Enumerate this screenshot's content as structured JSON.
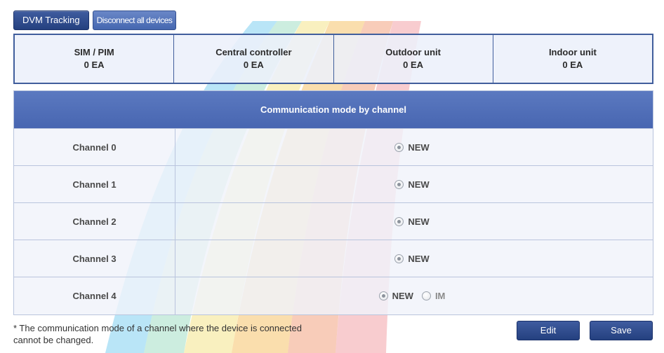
{
  "toolbar": {
    "dvm_tracking_label": "DVM Tracking",
    "disconnect_label": "Disconnect all devices"
  },
  "summary": [
    {
      "title": "SIM / PIM",
      "count": "0 EA"
    },
    {
      "title": "Central controller",
      "count": "0 EA"
    },
    {
      "title": "Outdoor unit",
      "count": "0 EA"
    },
    {
      "title": "Indoor unit",
      "count": "0 EA"
    }
  ],
  "channels": {
    "header": "Communication mode by channel",
    "rows": [
      {
        "label": "Channel 0",
        "option_new": "NEW"
      },
      {
        "label": "Channel 1",
        "option_new": "NEW"
      },
      {
        "label": "Channel 2",
        "option_new": "NEW"
      },
      {
        "label": "Channel 3",
        "option_new": "NEW"
      },
      {
        "label": "Channel 4",
        "option_new": "NEW",
        "option_im": "IM"
      }
    ]
  },
  "footer": {
    "note_line1": "* The communication mode of a channel where the device is connected",
    "note_line2": "cannot be changed.",
    "edit_label": "Edit",
    "save_label": "Save"
  },
  "colors": {
    "header_blue": "#4f6db6",
    "button_navy": "#2d4a8c",
    "border_blue": "#405e9c"
  }
}
